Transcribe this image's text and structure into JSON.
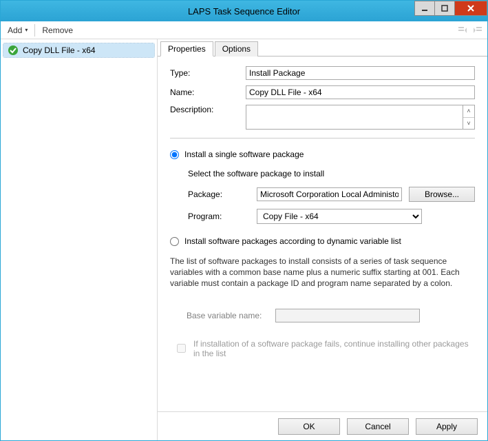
{
  "window": {
    "title": "LAPS Task Sequence Editor"
  },
  "toolbar": {
    "add_label": "Add",
    "remove_label": "Remove"
  },
  "tree": {
    "items": [
      {
        "label": "Copy DLL File - x64",
        "selected": true
      }
    ]
  },
  "tabs": {
    "properties_label": "Properties",
    "options_label": "Options",
    "active": "properties"
  },
  "properties": {
    "labels": {
      "type": "Type:",
      "name": "Name:",
      "description": "Description:"
    },
    "type_value": "Install Package",
    "name_value": "Copy DLL File - x64",
    "description_value": ""
  },
  "install_mode": {
    "single_label": "Install a single software package",
    "dynamic_label": "Install software packages according to dynamic variable list",
    "selected": "single"
  },
  "single": {
    "prompt": "Select the software package to install",
    "labels": {
      "package": "Package:",
      "program": "Program:"
    },
    "package_value": "Microsoft Corporation Local Administor Password S",
    "program_value": "Copy File - x64",
    "browse_label": "Browse..."
  },
  "dynamic": {
    "info_text": "The list of software packages to install consists of a series of task sequence variables with a common base name plus a numeric suffix starting at 001.  Each variable must contain a package ID and program name separated by a colon.",
    "base_var_label": "Base variable name:",
    "base_var_value": "",
    "continue_label": "If installation of a software package fails, continue installing other packages in the list"
  },
  "footer": {
    "ok_label": "OK",
    "cancel_label": "Cancel",
    "apply_label": "Apply"
  }
}
